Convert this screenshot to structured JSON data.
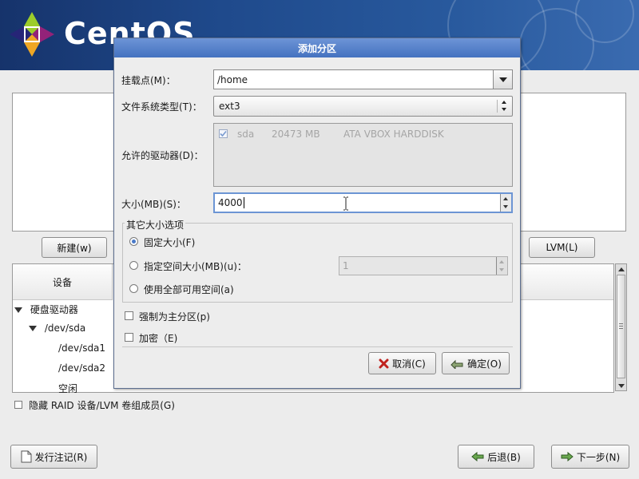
{
  "brand": {
    "logo_text": "CentOS",
    "banner_color": "#1f4a8c"
  },
  "main": {
    "buttons": {
      "new_label": "新建(w)",
      "lvm_label": "LVM(L)"
    },
    "device_table": {
      "header_device": "设备",
      "rows": [
        {
          "label": "硬盘驱动器",
          "expanded": true,
          "level": 0
        },
        {
          "label": "/dev/sda",
          "expanded": true,
          "level": 1
        },
        {
          "label": "/dev/sda1",
          "level": 2
        },
        {
          "label": "/dev/sda2",
          "level": 2
        },
        {
          "label": "空闲",
          "level": 2
        }
      ]
    },
    "hide_raid_label": "隐藏 RAID 设备/LVM 卷组成员(G)",
    "hide_raid_checked": false
  },
  "footer": {
    "release_notes_label": "发行注记(R)",
    "back_label": "后退(B)",
    "next_label": "下一步(N)"
  },
  "dialog": {
    "title": "添加分区",
    "mount_point": {
      "label": "挂载点(M)：",
      "value": "/home"
    },
    "fs_type": {
      "label": "文件系统类型(T)：",
      "value": "ext3"
    },
    "drives": {
      "label": "允许的驱动器(D)：",
      "rows": [
        {
          "checked": true,
          "name": "sda",
          "size": "20473 MB",
          "model": "ATA VBOX HARDDISK"
        }
      ]
    },
    "size": {
      "label": "大小(MB)(S)：",
      "value": "4000"
    },
    "other_options": {
      "group_label": "其它大小选项",
      "fixed_label": "固定大小(F)",
      "fixed_selected": true,
      "upto_label": "指定空间大小(MB)(u)：",
      "upto_value": "1",
      "fill_label": "使用全部可用空间(a)"
    },
    "force_primary_label": "强制为主分区(p)",
    "encrypt_label": "加密（E)",
    "cancel_label": "取消(C)",
    "ok_label": "确定(O)"
  },
  "colors": {
    "titlebar": "#4472c0",
    "radio_selected": "#4a7ac8",
    "check_disabled": "#7a9cd0"
  }
}
